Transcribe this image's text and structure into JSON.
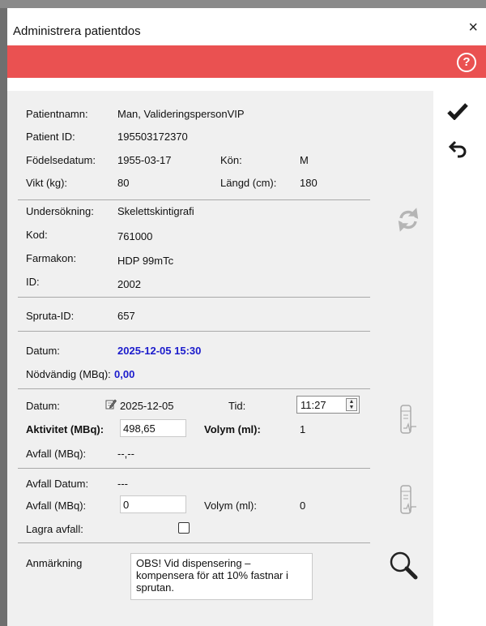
{
  "window": {
    "title": "Administrera patientdos",
    "close_glyph": "×",
    "help_glyph": "?",
    "accent_color": "#ea5151"
  },
  "patient": {
    "name_label": "Patientnamn:",
    "name_value": "Man, ValideringspersonVIP",
    "id_label": "Patient ID:",
    "id_value": "195503172370",
    "birth_label": "Födelsedatum:",
    "birth_value": "1955-03-17",
    "sex_label": "Kön:",
    "sex_value": "M",
    "weight_label": "Vikt (kg):",
    "weight_value": "80",
    "height_label": "Längd (cm):",
    "height_value": "180"
  },
  "exam": {
    "exam_label": "Undersökning:",
    "exam_value": "Skelettskintigrafi",
    "code_label": "Kod:",
    "code_value": "761000",
    "drug_label": "Farmakon:",
    "drug_value": "HDP 99mTc",
    "id_label": "ID:",
    "id_value": "2002"
  },
  "syringe": {
    "label": "Spruta-ID:",
    "value": "657"
  },
  "planned": {
    "date_label": "Datum:",
    "date_value": "2025-12-05 15:30",
    "required_label": "Nödvändig (MBq):",
    "required_value": "0,00"
  },
  "measure": {
    "date_label": "Datum:",
    "date_value": "2025-12-05",
    "time_label": "Tid:",
    "time_value": "11:27",
    "activity_label": "Aktivitet (MBq):",
    "activity_value": "498,65",
    "volume_label": "Volym (ml):",
    "volume_value": "1",
    "waste_label": "Avfall (MBq):",
    "waste_value": "--,--"
  },
  "waste": {
    "date_label": "Avfall Datum:",
    "date_value": "---",
    "mbq_label": "Avfall (MBq):",
    "mbq_value": "0",
    "volume_label": "Volym (ml):",
    "volume_value": "0",
    "store_label": "Lagra avfall:",
    "store_checked": false
  },
  "remark": {
    "label": "Anmärkning",
    "text": "OBS! Vid dispensering – kompensera för att 10% fastnar i sprutan."
  },
  "icons": [
    "close-icon",
    "help-icon",
    "checkmark-icon",
    "undo-icon",
    "refresh-icon",
    "calendar-edit-icon",
    "syringe-measure-icon",
    "syringe-waste-icon",
    "search-icon"
  ]
}
